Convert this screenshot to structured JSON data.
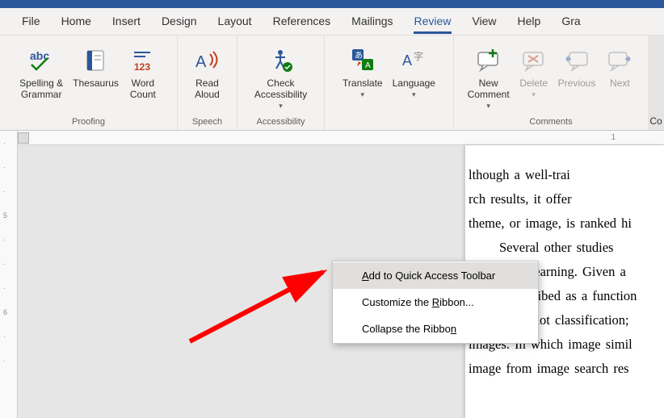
{
  "tabs": [
    "File",
    "Home",
    "Insert",
    "Design",
    "Layout",
    "References",
    "Mailings",
    "Review",
    "View",
    "Help",
    "Gra"
  ],
  "active_tab_index": 7,
  "groups": {
    "proofing": {
      "label": "Proofing",
      "spelling": "Spelling &\nGrammar",
      "thesaurus": "Thesaurus",
      "wordcount": "Word\nCount"
    },
    "speech": {
      "label": "Speech",
      "read_aloud": "Read\nAloud"
    },
    "accessibility": {
      "label": "Accessibility",
      "check": "Check\nAccessibility"
    },
    "language": {
      "translate": "Translate",
      "language": "Language"
    },
    "comments": {
      "label": "Comments",
      "new_comment": "New\nComment",
      "delete": "Delete",
      "previous": "Previous",
      "next": "Next",
      "partial": "Co"
    }
  },
  "ruler": {
    "h_mark": "1",
    "v_marks": [
      "",
      "5",
      "",
      "6"
    ]
  },
  "document": {
    "lines": [
      "lthough a well-trai",
      "rch results, it offer",
      "theme, or image, is ranked hi",
      "Several other studies",
      "supervised learning. Given a",
      "can be described as a function",
      "our goal is not classification;",
      "images. In which image simil",
      "image from image search res"
    ]
  },
  "context_menu": {
    "items": [
      {
        "pre": "",
        "u": "A",
        "post": "dd to Quick Access Toolbar"
      },
      {
        "pre": "Customize the ",
        "u": "R",
        "post": "ibbon..."
      },
      {
        "pre": "Collapse the Ribbo",
        "u": "n",
        "post": ""
      }
    ],
    "highlight_index": 0
  }
}
